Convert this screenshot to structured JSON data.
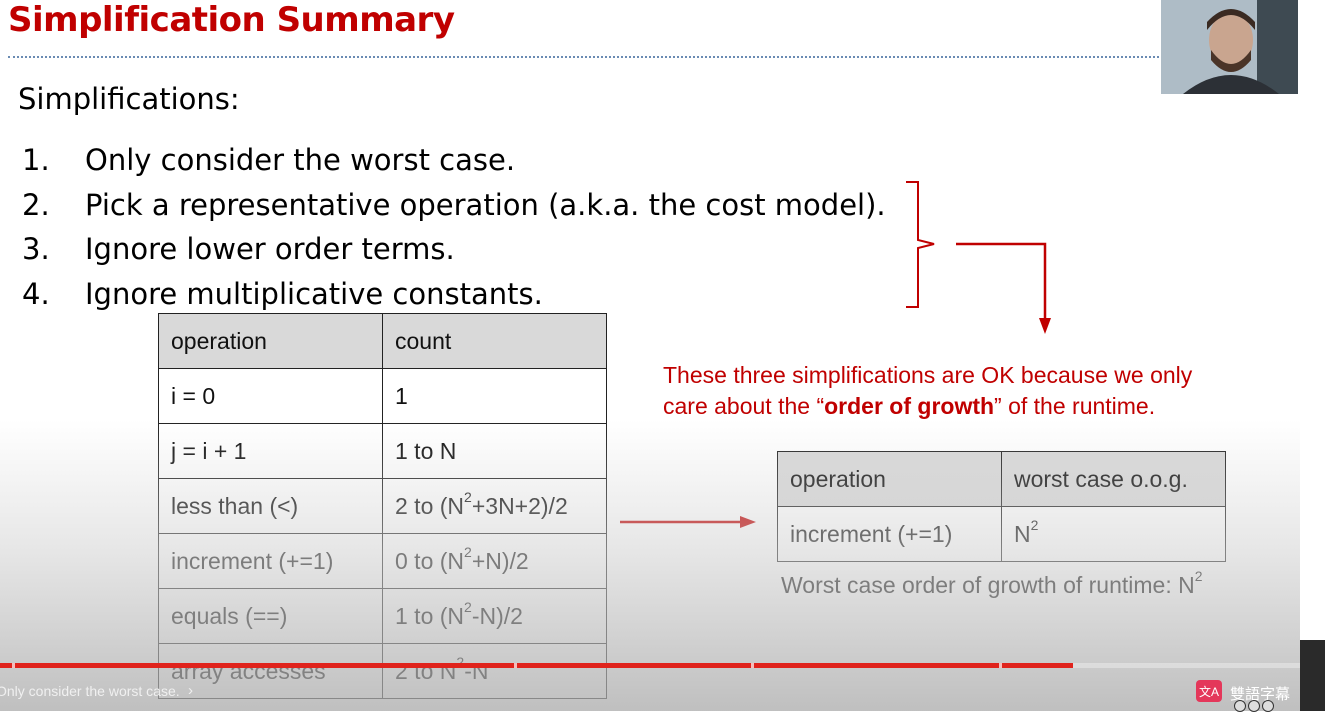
{
  "slide": {
    "title": "Simplification Summary",
    "subheading": "Simplifications:",
    "list": [
      {
        "num": "1.",
        "text": "Only consider the worst case."
      },
      {
        "num": "2.",
        "text": "Pick a representative operation (a.k.a. the cost model)."
      },
      {
        "num": "3.",
        "text": "Ignore lower order terms."
      },
      {
        "num": "4.",
        "text": "Ignore multiplicative constants."
      }
    ],
    "table1": {
      "headers": [
        "operation",
        "count"
      ],
      "rows": [
        [
          "i = 0",
          "1"
        ],
        [
          "j = i + 1",
          "1 to N"
        ],
        [
          "less than (<)",
          "2 to (N2+3N+2)/2"
        ],
        [
          "increment (+=1)",
          "0 to (N2+N)/2"
        ],
        [
          "equals (==)",
          "1 to (N2-N)/2"
        ],
        [
          "array accesses",
          "2 to N2-N"
        ]
      ]
    },
    "note": {
      "line1": "These three simplifications are OK because we only",
      "line2_before": "care about the “",
      "line2_bold": "order of growth",
      "line2_after": "” of the runtime."
    },
    "table2": {
      "headers": [
        "operation",
        "worst case o.o.g."
      ],
      "rows": [
        [
          "increment (+=1)",
          "N2"
        ]
      ]
    },
    "caption_prefix": "Worst case order of growth of runtime: N",
    "caption_exp": "2"
  },
  "player": {
    "chapter_title": "Only consider the worst case.",
    "bilingual_label": "雙語字幕",
    "bilingual_button": "文A",
    "progress_percent": 81
  },
  "colors": {
    "accent": "#c00000",
    "progress": "#e0231c",
    "header_fill": "#d9d9d9"
  }
}
